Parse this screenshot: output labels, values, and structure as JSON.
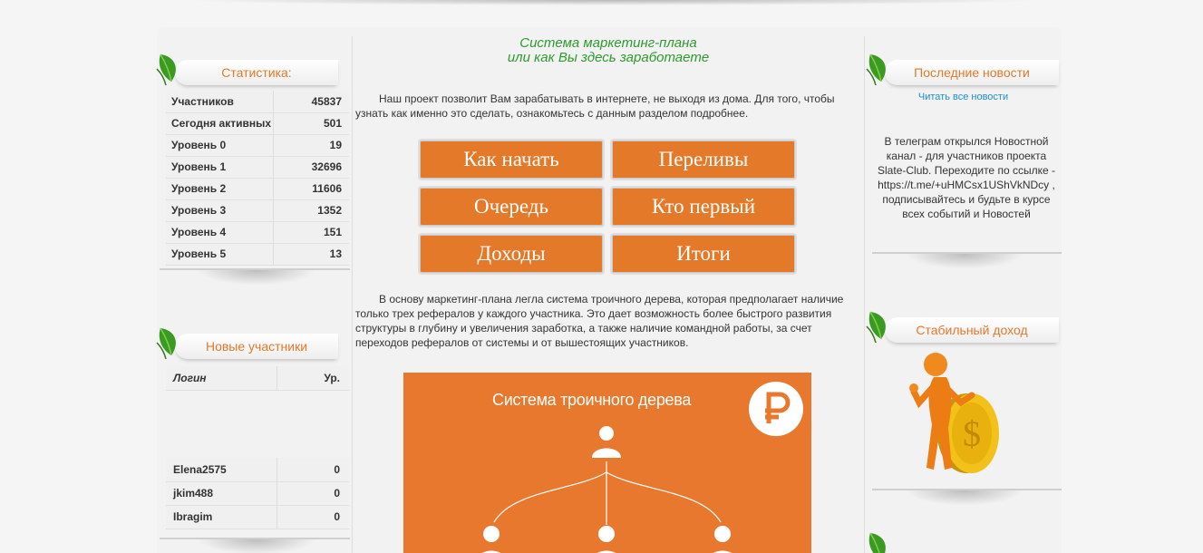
{
  "main": {
    "title_line1": "Система маркетинг-плана",
    "title_line2": "или как Вы здесь заработаете",
    "intro": "Наш проект позволит Вам зарабатывать в интернете, не выходя из дома. Для того, чтобы узнать как именно это сделать, ознакомьтесь с данным разделом подробнее.",
    "buttons": [
      "Как начать",
      "Переливы",
      "Очередь",
      "Кто первый",
      "Доходы",
      "Итоги"
    ],
    "body": "В основу маркетинг-плана легла система троичного дерева, которая предполагает наличие только трех рефералов у каждого участника. Это дает возможность более быстрого развития структуры в глубину и увеличения заработка, а также наличие командной работы, за счет переходов рефералов от системы и от вышестоящих участников.",
    "image_title": "Система троичного дерева"
  },
  "stats": {
    "title": "Статистика:",
    "rows": [
      {
        "label": "Участников",
        "value": "45837"
      },
      {
        "label": "Сегодня активных",
        "value": "501"
      },
      {
        "label": "Уровень 0",
        "value": "19"
      },
      {
        "label": "Уровень 1",
        "value": "32696"
      },
      {
        "label": "Уровень 2",
        "value": "11606"
      },
      {
        "label": "Уровень 3",
        "value": "1352"
      },
      {
        "label": "Уровень 4",
        "value": "151"
      },
      {
        "label": "Уровень 5",
        "value": "13"
      }
    ]
  },
  "new_users": {
    "title": "Новые участники",
    "col_login": "Логин",
    "col_level": "Ур.",
    "rows": [
      {
        "login": "Elena2575",
        "level": "0"
      },
      {
        "login": "jkim488",
        "level": "0"
      },
      {
        "login": "Ibragim",
        "level": "0"
      }
    ]
  },
  "news": {
    "title": "Последние новости",
    "read_all": "Читать все новости",
    "text": "В телеграм открылся Новостной канал - для участников проекта Slate-Club. Переходите по ссылке - https://t.me/+uHMCsx1UShVkNDcy , подписывайтесь и будьте в курсе всех событий и Новостей"
  },
  "income": {
    "title": "Стабильный доход"
  },
  "colors": {
    "accent_orange": "#e4792a",
    "title_green": "#2f9a2f",
    "link_blue": "#1e8fc9"
  },
  "icons": [
    "leaf-icon",
    "ruble-icon",
    "user-icon",
    "figure-coin-illustration"
  ]
}
